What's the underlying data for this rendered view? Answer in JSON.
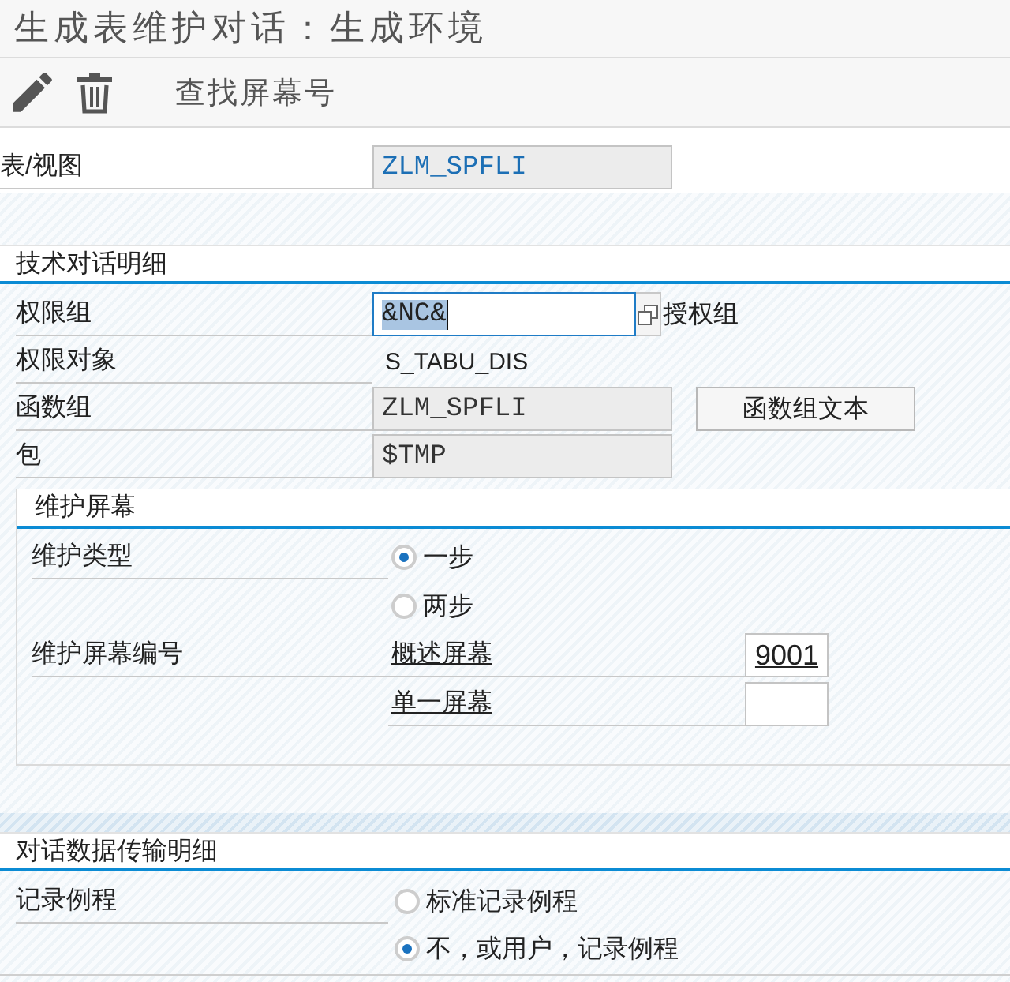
{
  "window": {
    "title": "生成表维护对话：生成环境"
  },
  "toolbar": {
    "find_button": "查找屏幕号"
  },
  "table_view": {
    "label": "表/视图",
    "value": "ZLM_SPFLI"
  },
  "technical_details": {
    "title": "技术对话明细",
    "rows": [
      {
        "kind": "input",
        "label": "权限组",
        "value": "&NC&",
        "focused": true,
        "description": "授权组"
      },
      {
        "kind": "text",
        "label": "权限对象",
        "value": "S_TABU_DIS"
      },
      {
        "kind": "display",
        "label": "函数组",
        "value": "ZLM_SPFLI",
        "button": "函数组文本"
      },
      {
        "kind": "display",
        "label": "包",
        "value": "$TMP"
      }
    ],
    "maintenance_screen": {
      "title": "维护屏幕",
      "type": {
        "label": "维护类型",
        "options": [
          {
            "label": "一步",
            "selected": true
          },
          {
            "label": "两步",
            "selected": false
          }
        ]
      },
      "numbers": {
        "label": "维护屏幕编号",
        "fields": [
          {
            "label": "概述屏幕",
            "value": "9001"
          },
          {
            "label": "单一屏幕"
          }
        ]
      }
    }
  },
  "data_transfer": {
    "title": "对话数据传输明细",
    "recording_routine": {
      "label": "记录例程",
      "options": [
        {
          "label": "标准记录例程",
          "selected": false
        },
        {
          "label": "不，或用户，记录例程",
          "selected": true
        }
      ]
    }
  }
}
